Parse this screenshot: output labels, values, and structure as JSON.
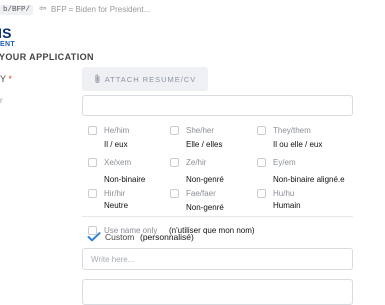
{
  "header": {
    "url": "b/BFP/",
    "back_icon": "back-arrow-icon",
    "page_description": "BFP = Biden for President..."
  },
  "logo": {
    "main": "IS",
    "sub": "ENT"
  },
  "section_title": "YOUR APPLICATION",
  "field": {
    "label": "Y",
    "required_mark": "*",
    "stub": "r"
  },
  "attach_button": {
    "label": "ATTACH RESUME/CV",
    "icon": "paperclip-icon"
  },
  "pronouns": [
    {
      "label": "He/him",
      "translation": "Il / eux"
    },
    {
      "label": "She/her",
      "translation": "Elle / elles"
    },
    {
      "label": "They/them",
      "translation": "Il ou elle / eux"
    },
    {
      "label": "Xe/xem",
      "translation": "Non-binaire"
    },
    {
      "label": "Ze/hir",
      "translation": "Non-genré"
    },
    {
      "label": "Ey/em",
      "translation": "Non-binaire aligné.e"
    },
    {
      "label": "Hir/hir",
      "translation": "Neutre"
    },
    {
      "label": "Fae/faer",
      "translation": "Non-genré"
    },
    {
      "label": "Hu/hu",
      "translation": "Humain"
    }
  ],
  "name_only": {
    "label": "Use name only",
    "translation": "(n'utiliser que mon nom)"
  },
  "custom": {
    "label": "Custom",
    "translation": "(personnalisé)",
    "checked": true,
    "check_icon": "checkmark-icon",
    "check_color": "#2f7fd0",
    "placeholder": "Write here..."
  }
}
